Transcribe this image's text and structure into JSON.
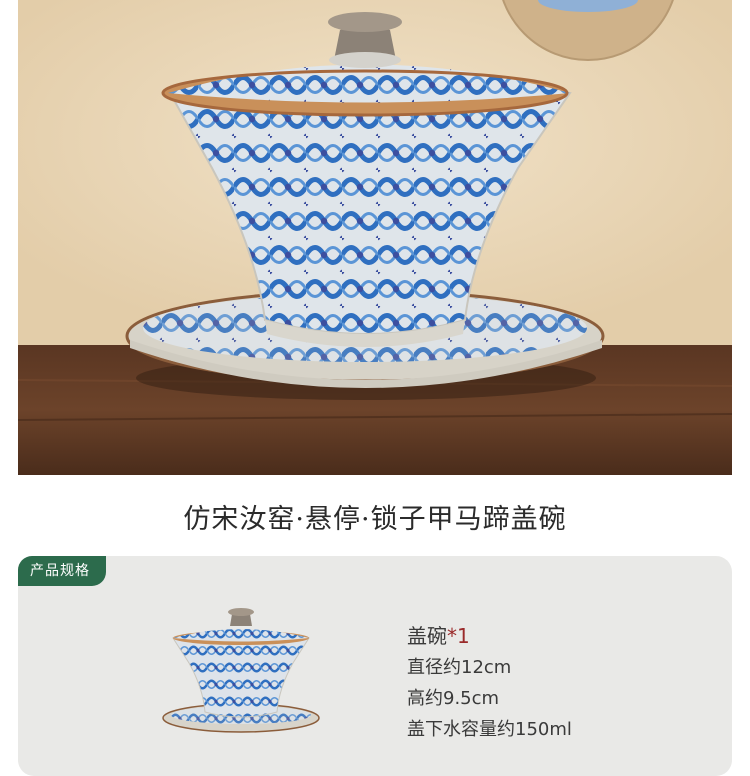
{
  "product": {
    "title": "仿宋汝窑·悬停·锁子甲马蹄盖碗"
  },
  "spec": {
    "tag": "产品规格",
    "item_name": "盖碗",
    "item_qty": "*1",
    "lines": [
      "直径约12cm",
      "高约9.5cm",
      "盖下水容量约150ml"
    ]
  },
  "colors": {
    "tag_green": "#2c6b4c",
    "qty_red": "#9a2a2a",
    "pattern_blue": "#2f6fc0"
  }
}
